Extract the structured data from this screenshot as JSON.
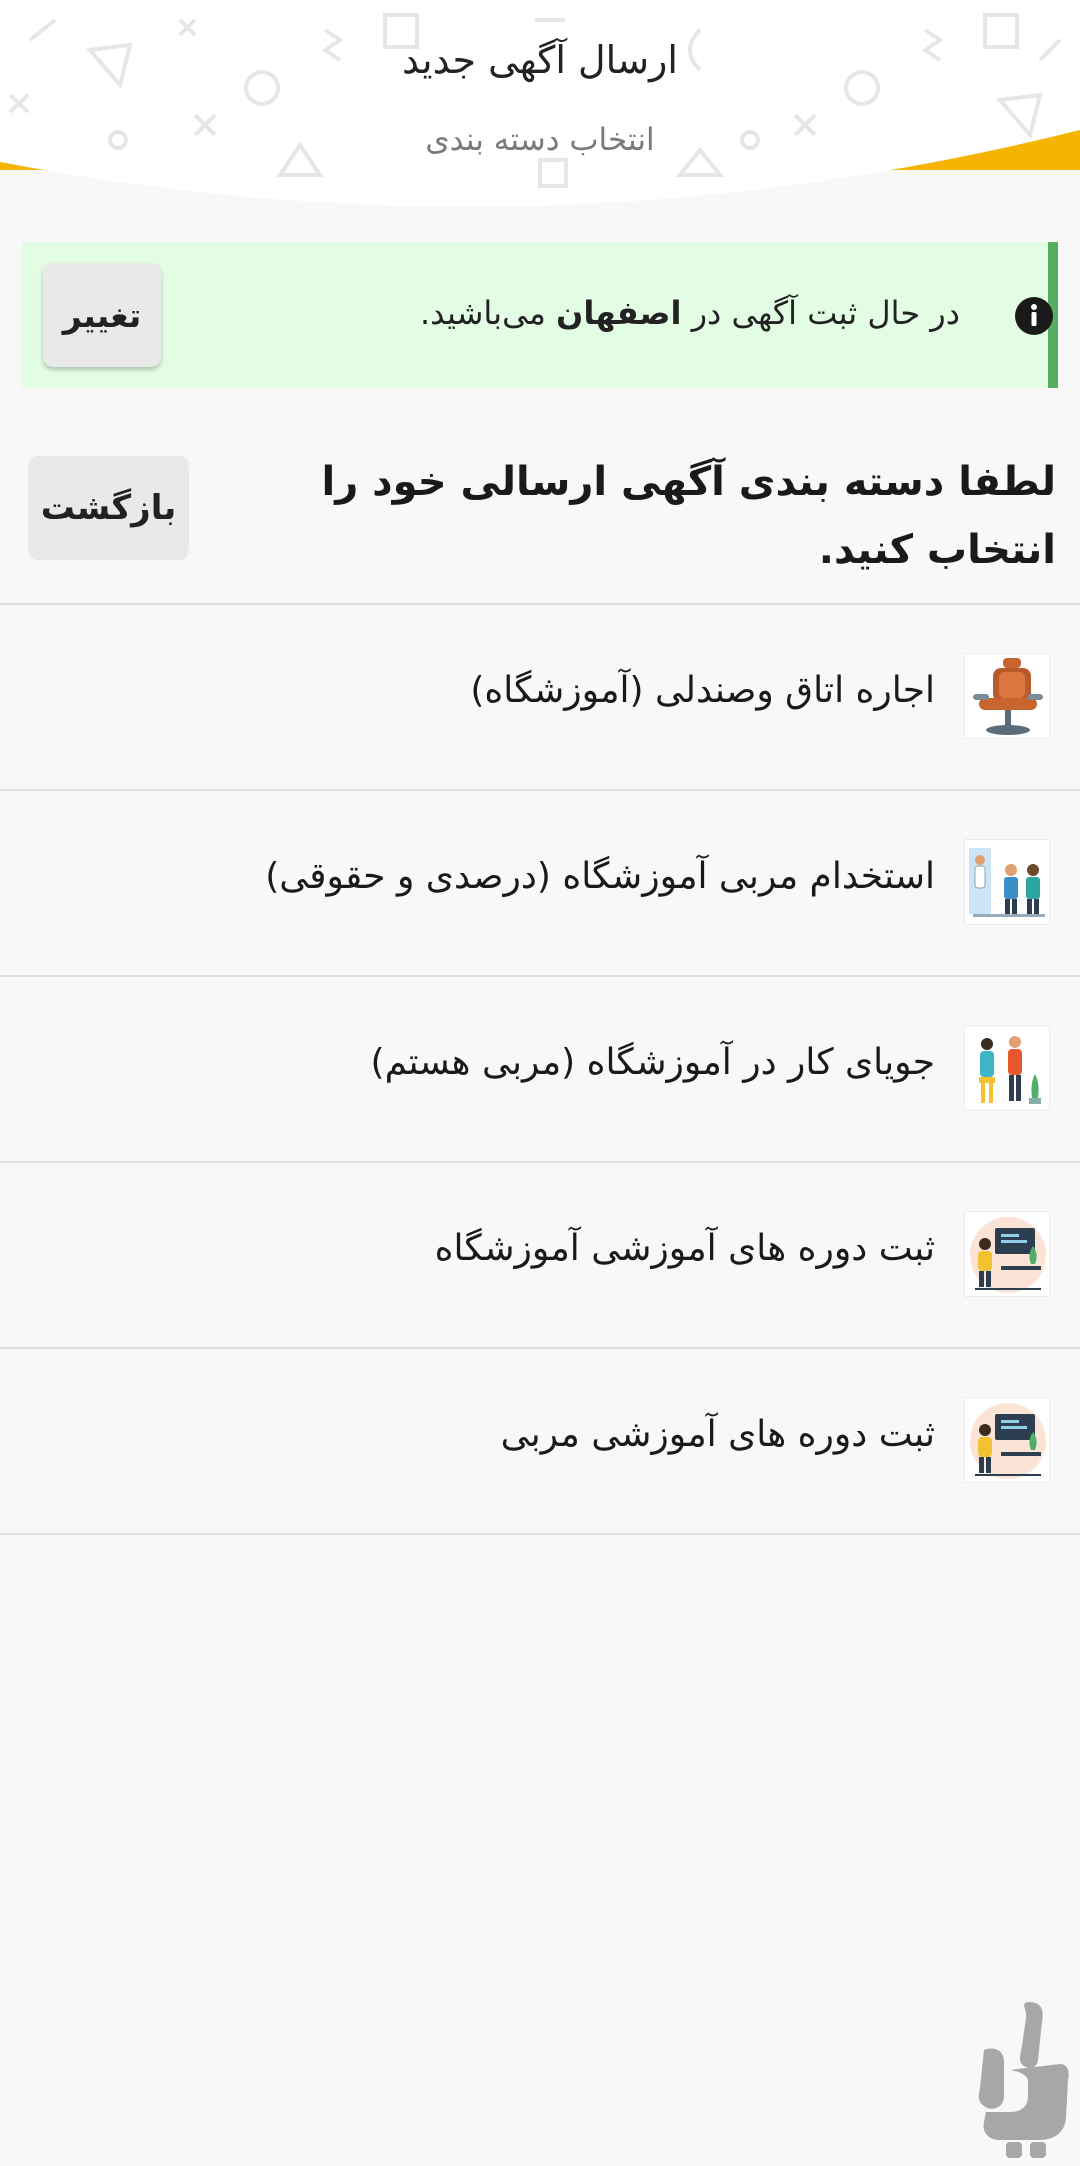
{
  "header": {
    "title": "ارسال آگهی جدید",
    "subtitle": "انتخاب دسته بندی",
    "accent_color": "#f5b400"
  },
  "location_notice": {
    "prefix": "در حال ثبت آگهی در ",
    "city": "اصفهان",
    "suffix": " می‌باشید.",
    "change_label": "تغییر",
    "info_icon": "info-icon",
    "background_color": "#e3fde5",
    "border_color": "#59ad61"
  },
  "prompt": {
    "text": "لطفا دسته بندی آگهی ارسالی خود را انتخاب کنید.",
    "back_label": "بازگشت"
  },
  "categories": [
    {
      "label": "اجاره اتاق وصندلی (آموزشگاه)",
      "icon": "barber-chair-icon"
    },
    {
      "label": "استخدام مربی آموزشگاه (درصدی و حقوقی)",
      "icon": "hiring-staff-icon"
    },
    {
      "label": "جویای کار در آموزشگاه (مربی هستم)",
      "icon": "job-seeker-icon"
    },
    {
      "label": "ثبت دوره های آموزشی آموزشگاه",
      "icon": "training-course-icon"
    },
    {
      "label": "ثبت دوره های آموزشی مربی",
      "icon": "trainer-course-icon"
    }
  ],
  "watermark": {
    "icon": "store-logo-icon"
  }
}
